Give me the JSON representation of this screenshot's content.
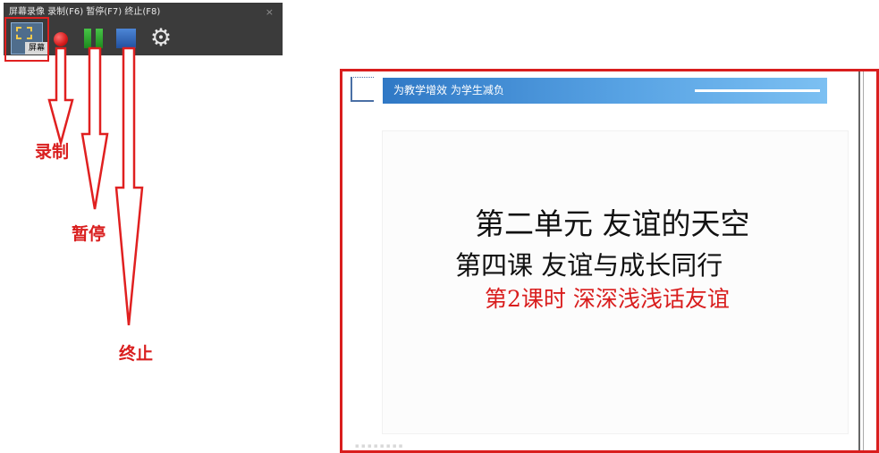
{
  "toolbar": {
    "title": "屏幕录像 录制(F6) 暂停(F7) 终止(F8)",
    "close_glyph": "×",
    "screen_label": "屏幕",
    "icons": {
      "screen": "screen-capture-icon",
      "record": "record-icon",
      "pause": "pause-icon",
      "stop": "stop-icon",
      "settings": "gear-icon"
    },
    "colors": {
      "background": "#3b3b3b",
      "record": "#d41b1b",
      "pause": "#2ea82e",
      "stop": "#2f66b8"
    }
  },
  "annotations": {
    "record_label": "录制",
    "pause_label": "暂停",
    "stop_label": "终止",
    "color": "#d91e1e"
  },
  "slide": {
    "header_text": "为教学增效 为学生减负",
    "line1": "第二单元  友谊的天空",
    "line2": "第四课    友谊与成长同行",
    "line3": "第2课时  深深浅浅话友谊",
    "colors": {
      "header": "#3a86d0",
      "highlight": "#d91e1e"
    }
  }
}
